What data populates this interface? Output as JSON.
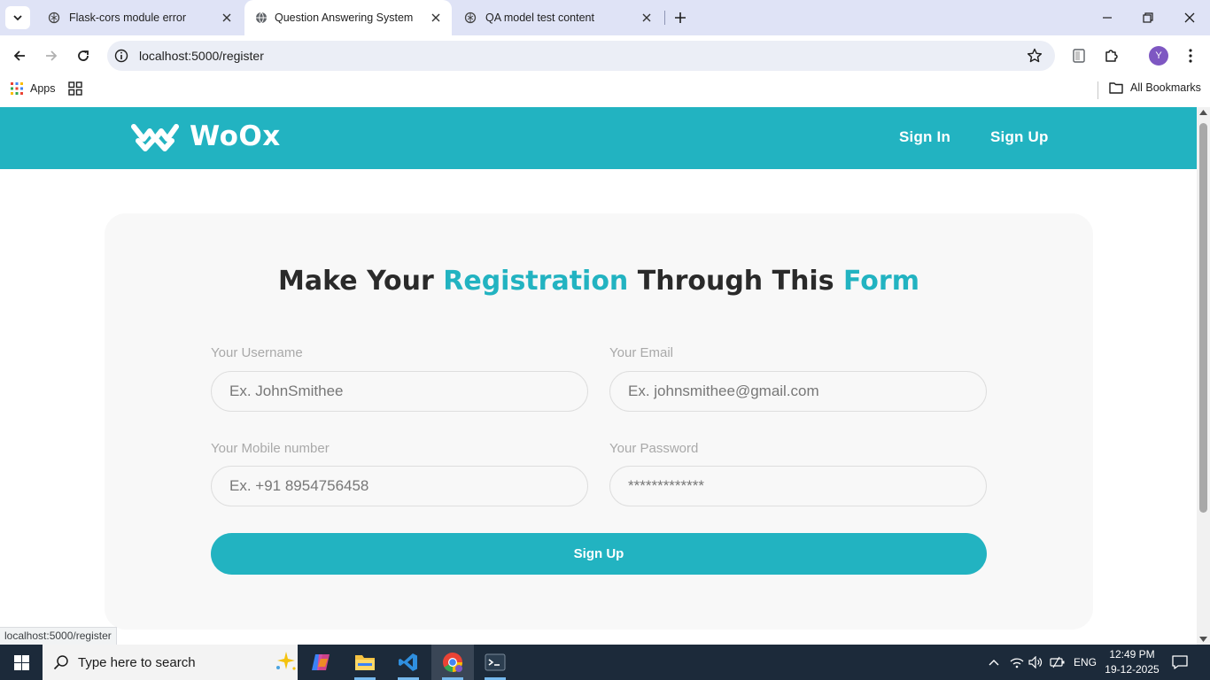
{
  "browser": {
    "tabs": [
      {
        "title": "Flask-cors module error",
        "active": false
      },
      {
        "title": "Question Answering System",
        "active": true
      },
      {
        "title": "QA model test content",
        "active": false
      }
    ],
    "url": "localhost:5000/register",
    "avatar_letter": "Y",
    "bookmarks": {
      "apps_label": "Apps",
      "all_label": "All Bookmarks"
    },
    "status_url": "localhost:5000/register"
  },
  "site": {
    "brand": "WoOx",
    "nav": {
      "sign_in": "Sign In",
      "sign_up": "Sign Up"
    }
  },
  "form": {
    "title_part1": "Make Your ",
    "title_accent1": "Registration",
    "title_part2": " Through This ",
    "title_accent2": "Form",
    "username": {
      "label": "Your Username",
      "placeholder": "Ex. JohnSmithee"
    },
    "email": {
      "label": "Your Email",
      "placeholder": "Ex. johnsmithee@gmail.com"
    },
    "mobile": {
      "label": "Your Mobile number",
      "placeholder": "Ex. +91 8954756458"
    },
    "password": {
      "label": "Your Password",
      "placeholder": "*************"
    },
    "submit_label": "Sign Up"
  },
  "taskbar": {
    "search_placeholder": "Type here to search",
    "language": "ENG",
    "time": "12:49 PM",
    "date": "19-12-2025"
  },
  "colors": {
    "accent": "#22b3c1",
    "title_dark": "#2a2a2a",
    "card_bg": "#f8f8f8",
    "taskbar_bg": "#1c2a3a",
    "tabstrip_bg": "#dfe3f6"
  }
}
